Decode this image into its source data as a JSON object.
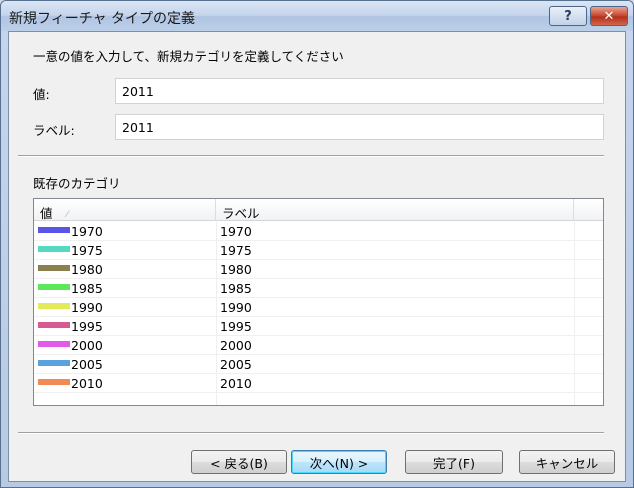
{
  "window": {
    "title": "新規フィーチャ タイプの定義",
    "help_label": "?",
    "close_label": "✕"
  },
  "form": {
    "instruction": "一意の値を入力して、新規カテゴリを定義してください",
    "value_label": "値:",
    "value": "2011",
    "label_label": "ラベル:",
    "label_value": "2011"
  },
  "existing": {
    "title": "既存のカテゴリ",
    "columns": [
      "値",
      "ラベル",
      ""
    ],
    "sort_indicator": "⁄",
    "rows": [
      {
        "value": "1970",
        "label": "1970",
        "color": "#5a55e6"
      },
      {
        "value": "1975",
        "label": "1975",
        "color": "#55d9c0"
      },
      {
        "value": "1980",
        "label": "1980",
        "color": "#8b7f4e"
      },
      {
        "value": "1985",
        "label": "1985",
        "color": "#5ce85a"
      },
      {
        "value": "1990",
        "label": "1990",
        "color": "#e5ea5a"
      },
      {
        "value": "1995",
        "label": "1995",
        "color": "#d85a92"
      },
      {
        "value": "2000",
        "label": "2000",
        "color": "#e45ae8"
      },
      {
        "value": "2005",
        "label": "2005",
        "color": "#5aa2dd"
      },
      {
        "value": "2010",
        "label": "2010",
        "color": "#f08a56"
      }
    ]
  },
  "buttons": {
    "back": "< 戻る(B)",
    "next": "次へ(N) >",
    "finish": "完了(F)",
    "cancel": "キャンセル"
  }
}
